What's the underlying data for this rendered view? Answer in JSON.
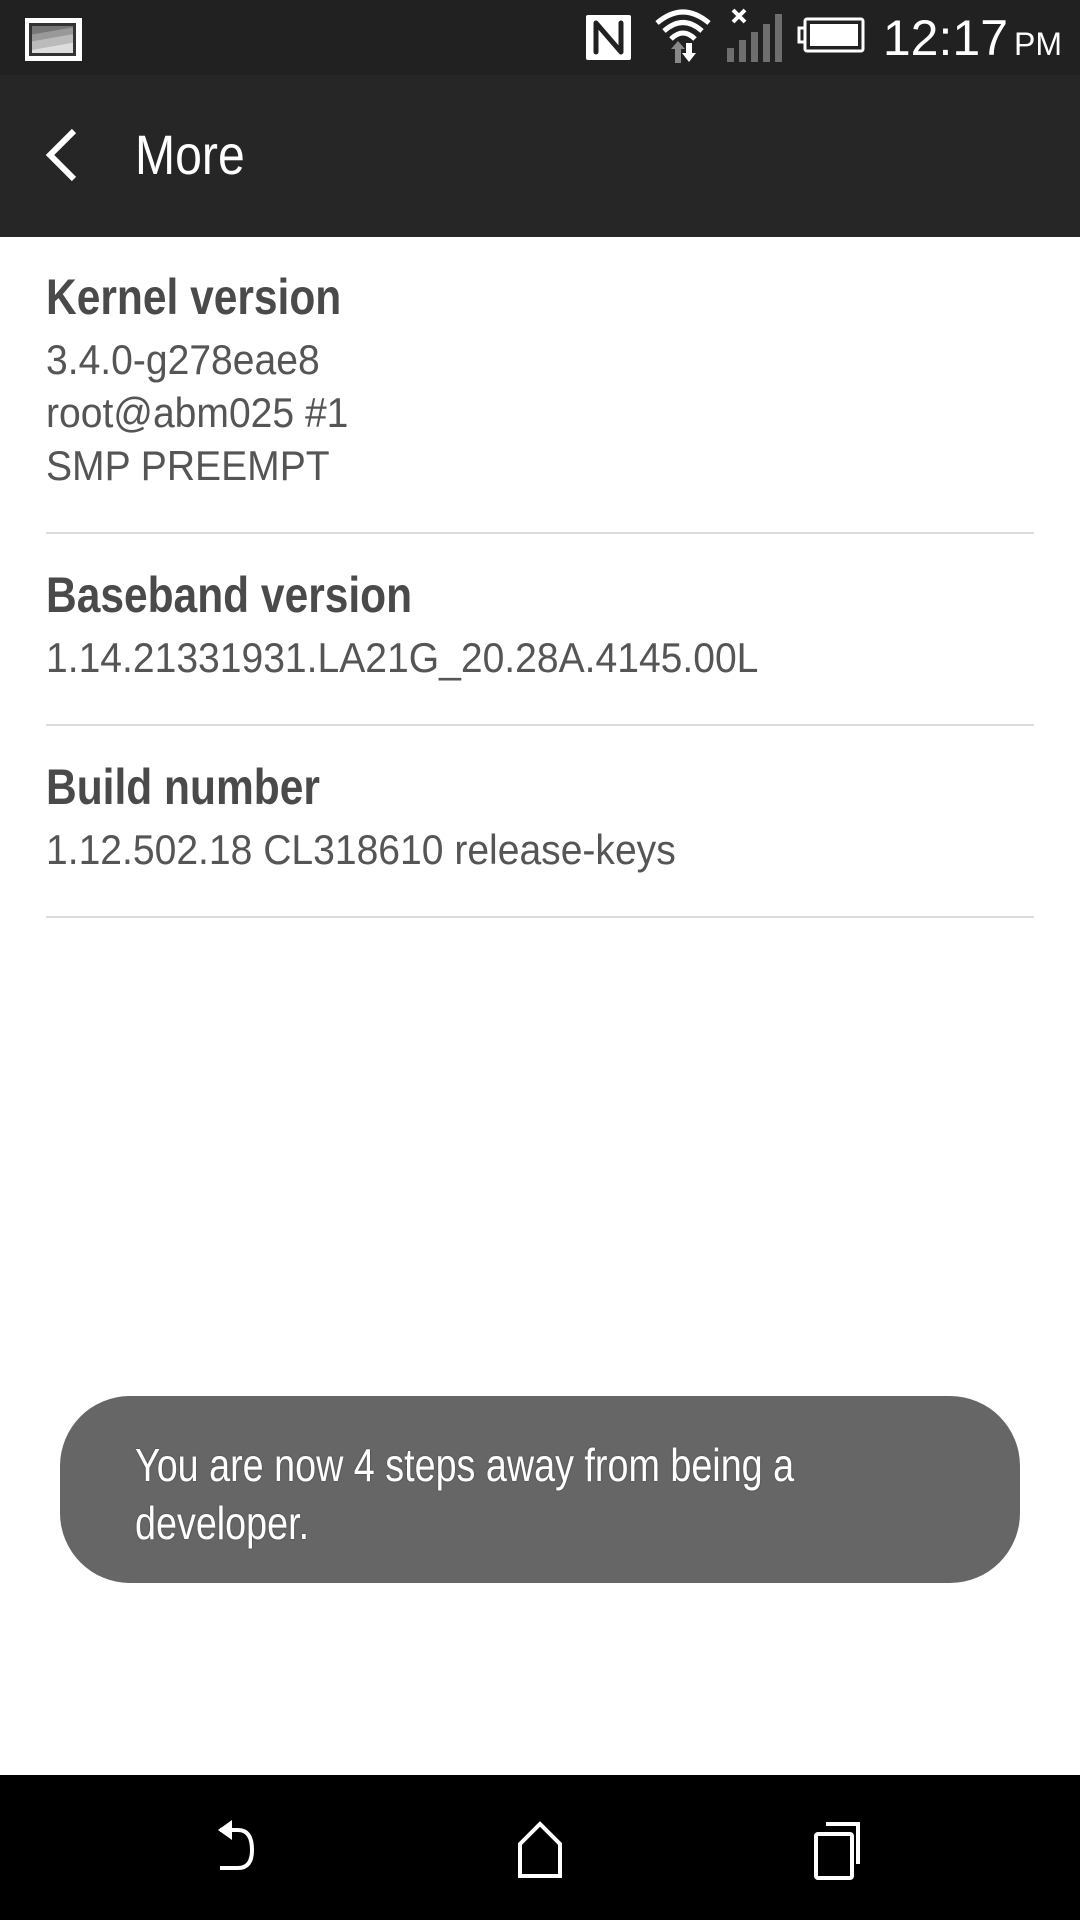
{
  "status_bar": {
    "notification_icon": "gallery-image-icon",
    "icons": [
      "nfc-icon",
      "wifi-data-activity-icon",
      "signal-no-service-icon",
      "battery-full-icon"
    ],
    "time": "12:17",
    "ampm": "PM"
  },
  "app_bar": {
    "back_icon": "chevron-left-icon",
    "title": "More"
  },
  "items": [
    {
      "title": "Kernel version",
      "value_lines": [
        "3.4.0-g278eae8",
        "root@abm025 #1",
        "SMP PREEMPT"
      ]
    },
    {
      "title": "Baseband version",
      "value_lines": [
        "1.14.21331931.LA21G_20.28A.4145.00L"
      ]
    },
    {
      "title": "Build number",
      "value_lines": [
        "1.12.502.18 CL318610 release-keys"
      ]
    }
  ],
  "toast": {
    "line1": "You are now 4 steps away from being a",
    "line2": "developer."
  },
  "nav_bar": {
    "buttons": [
      "back-icon",
      "home-icon",
      "recents-icon"
    ]
  },
  "colors": {
    "status_bar_bg": "#212121",
    "app_bar_bg": "#262626",
    "toast_bg": "#666666",
    "nav_bar_bg": "#000000",
    "divider": "#dcdcdc"
  }
}
